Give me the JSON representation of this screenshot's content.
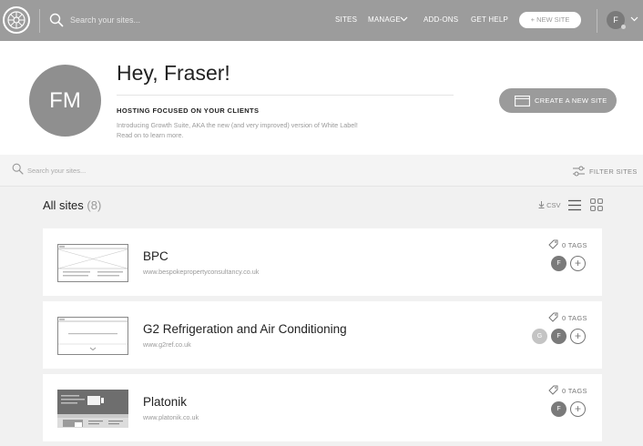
{
  "nav": {
    "search_placeholder": "Search your sites...",
    "links": {
      "sites": "SITES",
      "manage": "MANAGE",
      "addons": "ADD-ONS",
      "help": "GET HELP"
    },
    "new_site": "+  NEW SITE",
    "user_initial": "F"
  },
  "hero": {
    "initials": "FM",
    "greeting": "Hey, Fraser!",
    "subtitle": "HOSTING FOCUSED ON YOUR CLIENTS",
    "description": "Introducing Growth Suite, AKA the new (and very improved) version of White Label! Read on to learn more.",
    "create_button": "CREATE A NEW SITE"
  },
  "filter": {
    "search_placeholder": "Search your sites...",
    "filter_label": "FILTER SITES"
  },
  "list": {
    "title": "All sites",
    "count": "(8)",
    "csv": "CSV"
  },
  "sites": [
    {
      "name": "BPC",
      "url": "www.bespokepropertyconsultancy.co.uk",
      "tags": "0 TAGS",
      "collaborators": [
        "F"
      ]
    },
    {
      "name": "G2 Refrigeration and Air Conditioning",
      "url": "www.g2ref.co.uk",
      "tags": "0 TAGS",
      "collaborators": [
        "G",
        "F"
      ]
    },
    {
      "name": "Platonik",
      "url": "www.platonik.co.uk",
      "tags": "0 TAGS",
      "collaborators": [
        "F"
      ]
    }
  ],
  "colors": {
    "nav_bg": "#9c9c9c",
    "avatar_dark": "#7a7a7a",
    "avatar_light": "#c4c4c4",
    "card_bg": "#ffffff",
    "page_bg": "#f1f1f1"
  }
}
